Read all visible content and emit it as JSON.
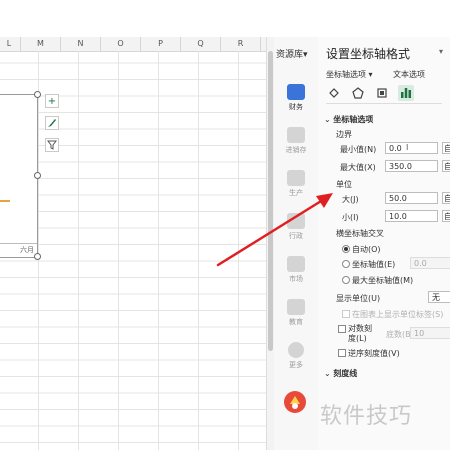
{
  "sheet": {
    "columns": [
      "L",
      "M",
      "N",
      "O",
      "P",
      "Q",
      "R"
    ],
    "chart_month_label": "六月",
    "chart_tools": [
      "+",
      "brush",
      "filter"
    ]
  },
  "resources": {
    "title": "资源库",
    "items": [
      {
        "label": "财务",
        "icon": "wallet-icon",
        "color": "#3b74d8"
      },
      {
        "label": "进销存",
        "icon": "store-icon",
        "color": "#cfcfcf"
      },
      {
        "label": "生产",
        "icon": "production-icon",
        "color": "#cfcfcf"
      },
      {
        "label": "行政",
        "icon": "admin-icon",
        "color": "#cfcfcf"
      },
      {
        "label": "市场",
        "icon": "market-icon",
        "color": "#cfcfcf"
      },
      {
        "label": "教育",
        "icon": "education-icon",
        "color": "#cfcfcf"
      },
      {
        "label": "更多",
        "icon": "more-icon",
        "color": "#cfcfcf"
      }
    ]
  },
  "panel": {
    "title": "设置坐标轴格式",
    "tabs": {
      "axis_options": "坐标轴选项",
      "text_options": "文本选项"
    },
    "section_axis_options": "坐标轴选项",
    "bounds_label": "边界",
    "min_label": "最小值(N)",
    "min_value": "0.0",
    "max_label": "最大值(X)",
    "max_value": "350.0",
    "auto_btn": "自动",
    "units_label": "单位",
    "major_label": "大(J)",
    "major_value": "50.0",
    "minor_label": "小(I)",
    "minor_value": "10.0",
    "cross_label": "横坐标轴交叉",
    "cross_auto": "自动(O)",
    "cross_value_label": "坐标轴值(E)",
    "cross_value": "0.0",
    "cross_max": "最大坐标轴值(M)",
    "display_units_label": "显示单位(U)",
    "display_units_value": "无",
    "show_units_label": "在图表上显示单位标签(S)",
    "log_scale_label": "对数刻度(L)",
    "base_label": "底数(B)",
    "base_value": "10",
    "reverse_label": "逆序刻度值(V)",
    "section_ticks": "刻度线"
  },
  "watermark": {
    "text": "软件技巧"
  },
  "colors": {
    "accent": "#1e7145",
    "arrow": "#e02020",
    "res_active": "#3b74d8"
  }
}
